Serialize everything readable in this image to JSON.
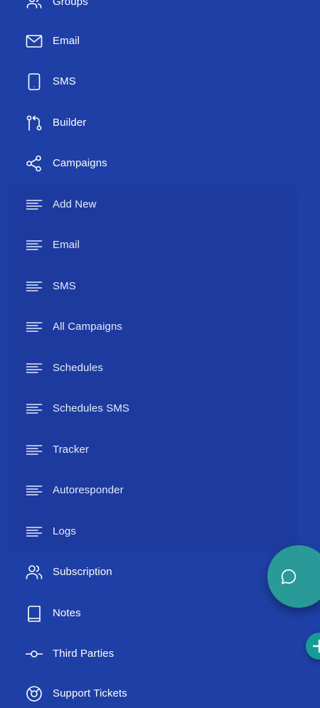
{
  "sidebar": {
    "groups_label": "Groups",
    "email_label": "Email",
    "sms_label": "SMS",
    "builder_label": "Builder",
    "campaigns_label": "Campaigns",
    "campaigns_submenu": {
      "add_new": "Add New",
      "email": "Email",
      "sms": "SMS",
      "all_campaigns": "All Campaigns",
      "schedules": "Schedules",
      "schedules_sms": "Schedules SMS",
      "tracker": "Tracker",
      "autoresponder": "Autoresponder",
      "logs": "Logs"
    },
    "subscription_label": "Subscription",
    "notes_label": "Notes",
    "third_parties_label": "Third Parties",
    "support_tickets_label": "Support Tickets"
  },
  "fab": {
    "chat_icon": "chat-bubble-icon",
    "add_icon": "plus-icon"
  },
  "colors": {
    "background": "#1e40a6",
    "submenu_background": "#1d3b9e",
    "text": "#ffffff",
    "fab_chat": "#2a9a98",
    "fab_add": "#169d93"
  }
}
